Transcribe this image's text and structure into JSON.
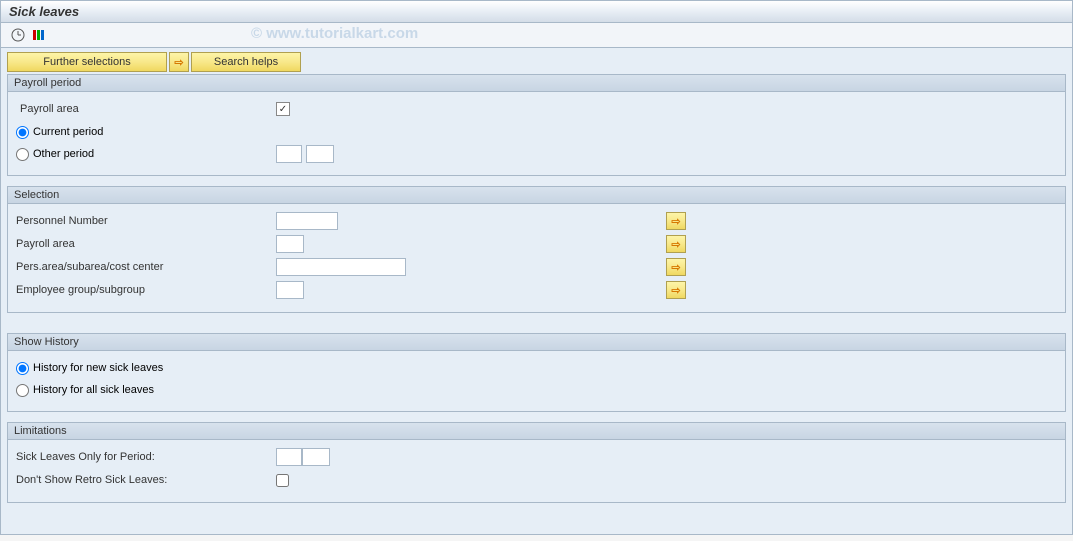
{
  "title": "Sick leaves",
  "watermark": "© www.tutorialkart.com",
  "toolbar": {
    "execute_icon": "execute",
    "variant_icon": "variant"
  },
  "buttons": {
    "further_selections": "Further selections",
    "search_helps": "Search helps"
  },
  "groups": {
    "payroll_period": {
      "title": "Payroll period",
      "payroll_area_label": "Payroll area",
      "payroll_area_checked": true,
      "current_period": "Current period",
      "other_period": "Other period",
      "selected": "current"
    },
    "selection": {
      "title": "Selection",
      "rows": [
        {
          "label": "Personnel Number",
          "size": "sm"
        },
        {
          "label": "Payroll area",
          "size": "xs"
        },
        {
          "label": "Pers.area/subarea/cost center",
          "size": "lg"
        },
        {
          "label": "Employee group/subgroup",
          "size": "xs"
        }
      ]
    },
    "show_history": {
      "title": "Show History",
      "new_sick": "History for new sick leaves",
      "all_sick": "History for all sick leaves",
      "selected": "new"
    },
    "limitations": {
      "title": "Limitations",
      "only_period_label": "Sick Leaves Only for Period:",
      "retro_label": "Don't Show Retro Sick Leaves:"
    }
  }
}
